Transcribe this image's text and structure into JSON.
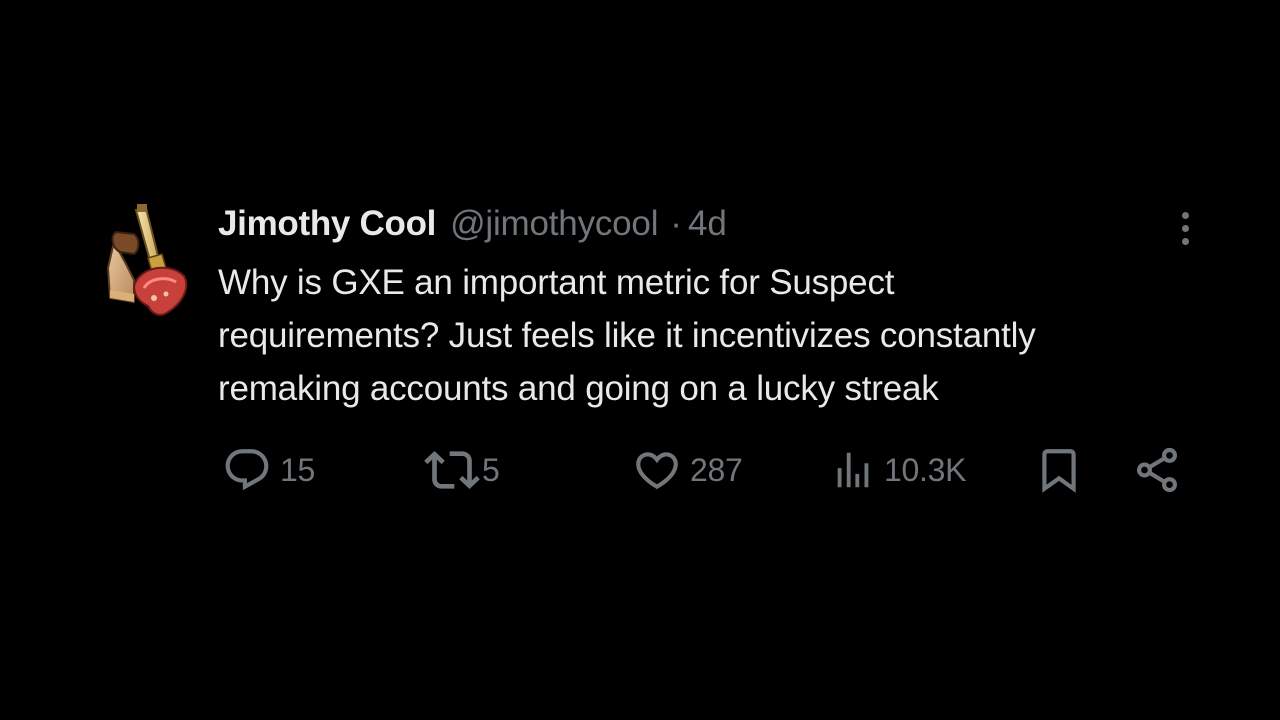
{
  "author": {
    "display_name": "Jimothy Cool",
    "handle": "@jimothycool",
    "separator": "·",
    "time": "4d",
    "avatar_icon": "avatar-icon"
  },
  "tweet": {
    "lines": [
      "Why is GXE an important metric for Suspect",
      "requirements? Just feels like it incentivizes constantly",
      "remaking accounts and going on a lucky streak"
    ]
  },
  "actions": {
    "replies": "15",
    "retweets": "5",
    "likes": "287",
    "views": "10.3K"
  },
  "colors": {
    "background": "#000000",
    "text": "#e7e9ea",
    "muted": "#71767b"
  }
}
